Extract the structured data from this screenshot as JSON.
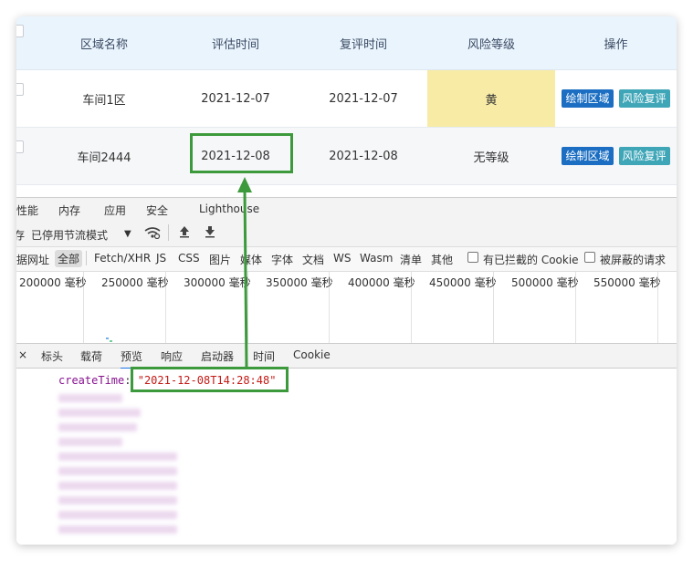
{
  "table": {
    "headers": [
      "区域名称",
      "评估时间",
      "复评时间",
      "风险等级",
      "操作"
    ],
    "rows": [
      {
        "area": "车间1区",
        "eval_time": "2021-12-07",
        "review_time": "2021-12-07",
        "risk": "黄",
        "action1": "绘制区域",
        "action2": "风险复评"
      },
      {
        "area": "车间2444",
        "eval_time": "2021-12-08",
        "review_time": "2021-12-08",
        "risk": "无等级",
        "action1": "绘制区域",
        "action2": "风险复评"
      }
    ]
  },
  "devtools": {
    "top_tabs": [
      "性能",
      "内存",
      "应用",
      "安全",
      "Lighthouse"
    ],
    "toolbar": {
      "throttle": "已停用节流模式"
    },
    "filters": [
      "据网址",
      "全部",
      "Fetch/XHR",
      "JS",
      "CSS",
      "图片",
      "媒体",
      "字体",
      "文档",
      "WS",
      "Wasm",
      "清单",
      "其他"
    ],
    "checkbox_blocked_cookies": "有已拦截的 Cookie",
    "checkbox_blocked_requests": "被屏蔽的请求",
    "timeline_labels": [
      "200000 毫秒",
      "250000 毫秒",
      "300000 毫秒",
      "350000 毫秒",
      "400000 毫秒",
      "450000 毫秒",
      "500000 毫秒",
      "550000 毫秒"
    ],
    "detail_tabs": [
      "标头",
      "载荷",
      "预览",
      "响应",
      "启动器",
      "时间",
      "Cookie"
    ],
    "close_glyph": "×",
    "preview": {
      "key": "createTime",
      "value": "\"2021-12-08T14:28:48\""
    }
  },
  "colors": {
    "risk_yellow": "#f7eba6",
    "highlight_green": "#3c9a3c",
    "btn_blue": "#1b6ec2",
    "btn_teal": "#3fa6b8"
  }
}
